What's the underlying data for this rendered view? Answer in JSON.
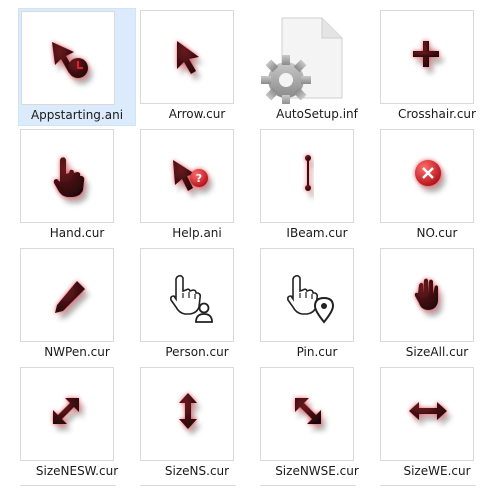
{
  "files": [
    {
      "name": "Appstarting.ani",
      "icon": "appstarting-cursor-icon",
      "selected": true
    },
    {
      "name": "Arrow.cur",
      "icon": "arrow-cursor-icon"
    },
    {
      "name": "AutoSetup.inf",
      "icon": "settings-file-icon"
    },
    {
      "name": "Crosshair.cur",
      "icon": "crosshair-cursor-icon"
    },
    {
      "name": "Hand.cur",
      "icon": "hand-cursor-icon"
    },
    {
      "name": "Help.ani",
      "icon": "help-cursor-icon"
    },
    {
      "name": "IBeam.cur",
      "icon": "ibeam-cursor-icon"
    },
    {
      "name": "NO.cur",
      "icon": "no-cursor-icon"
    },
    {
      "name": "NWPen.cur",
      "icon": "pen-cursor-icon"
    },
    {
      "name": "Person.cur",
      "icon": "person-cursor-icon"
    },
    {
      "name": "Pin.cur",
      "icon": "pin-cursor-icon"
    },
    {
      "name": "SizeAll.cur",
      "icon": "size-all-cursor-icon"
    },
    {
      "name": "SizeNESW.cur",
      "icon": "size-nesw-cursor-icon"
    },
    {
      "name": "SizeNS.cur",
      "icon": "size-ns-cursor-icon"
    },
    {
      "name": "SizeNWSE.cur",
      "icon": "size-nwse-cursor-icon"
    },
    {
      "name": "SizeWE.cur",
      "icon": "size-we-cursor-icon"
    }
  ],
  "colors": {
    "accent": "#e0222b",
    "selection": "#dcebfc",
    "border": "#d9d9d9"
  }
}
